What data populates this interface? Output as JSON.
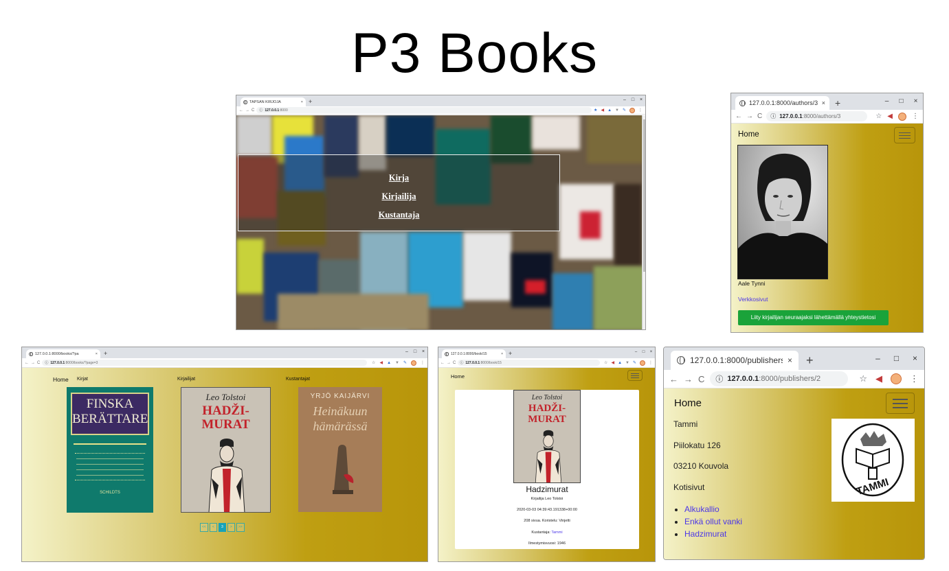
{
  "page_title": "P3 Books",
  "icons": {
    "back": "arrow-left-icon",
    "forward": "arrow-right-icon",
    "reload": "reload-icon",
    "info": "info-icon",
    "star": "bookmark-star-icon",
    "extension_megaphone": "megaphone-icon",
    "extension_hat": "graduation-hat-icon",
    "extension_v": "v-shield-icon",
    "extension_pen": "pen-icon",
    "profile": "avatar-icon",
    "menu": "more-vert-icon",
    "globe": "globe-icon",
    "hamburger": "hamburger-menu-icon"
  },
  "colors": {
    "accent_link": "#4b36e8",
    "follow_button": "#1aa33a",
    "pager_active": "#17a2b8",
    "gold_bg": "#bf9f12"
  },
  "window_home": {
    "tab_title": "TAPSAN KIRJOJA",
    "url_host": "127.0.0.1",
    "url_path": ":8000",
    "menu": [
      "Kirja",
      "Kirjailija",
      "Kustantaja"
    ]
  },
  "window_author": {
    "tab_title": "127.0.0.1:8000/authors/3",
    "url_host": "127.0.0.1",
    "url_path": ":8000/authors/3",
    "home": "Home",
    "author_name": "Aale Tynni",
    "website_link": "Verkkosivut",
    "follow_button": "Liity kirjailijan seuraajaksi lähettämällä yhteystietosi"
  },
  "window_books": {
    "tab_title": "127.0.0.1:8000/books/?pa",
    "url_host": "127.0.0.1",
    "url_path": ":8000/books/?page=3",
    "nav": {
      "home": "Home",
      "books": "Kirjat",
      "authors": "Kirjailijat",
      "publishers": "Kustantajat"
    },
    "covers": [
      {
        "title": "FINSKA BERÄTTARE",
        "publisher": "SCHILDTS"
      },
      {
        "author": "Leo Tolstoi",
        "title": "HADŽI-MURAT"
      },
      {
        "author": "YRJÖ KAIJÄRVI",
        "title": "Heinäkuun hämärässä"
      }
    ],
    "pager": [
      "<<",
      "<",
      "3",
      ">",
      ">>"
    ],
    "current_page": "3"
  },
  "window_book": {
    "tab_title": "127.0.0.1:8000/book/15",
    "url_host": "127.0.0.1",
    "url_path": ":8000/book/15",
    "home": "Home",
    "book_title": "Hadzimurat",
    "author_line": "Kirjailija Leo Tolstoi",
    "timestamp": "2020-03-03 04:39:43.191338+00:00",
    "pages_line": "208 sivua. Koristelu: Vinjetti",
    "publisher_label": "Kustantaja:",
    "publisher_link": "Tammi",
    "year_line": "Ilmestymisvuosi: 1946"
  },
  "window_publisher": {
    "tab_title": "127.0.0.1:8000/publishers",
    "url_host": "127.0.0.1",
    "url_path": ":8000/publishers/2",
    "home": "Home",
    "name": "Tammi",
    "street": "Piilokatu 126",
    "postal": "03210 Kouvola",
    "website_link": "Kotisivut",
    "logo_text": "TAMMI",
    "books": [
      "Alkukallio",
      "Enkä ollut vanki",
      "Hadzimurat"
    ]
  }
}
